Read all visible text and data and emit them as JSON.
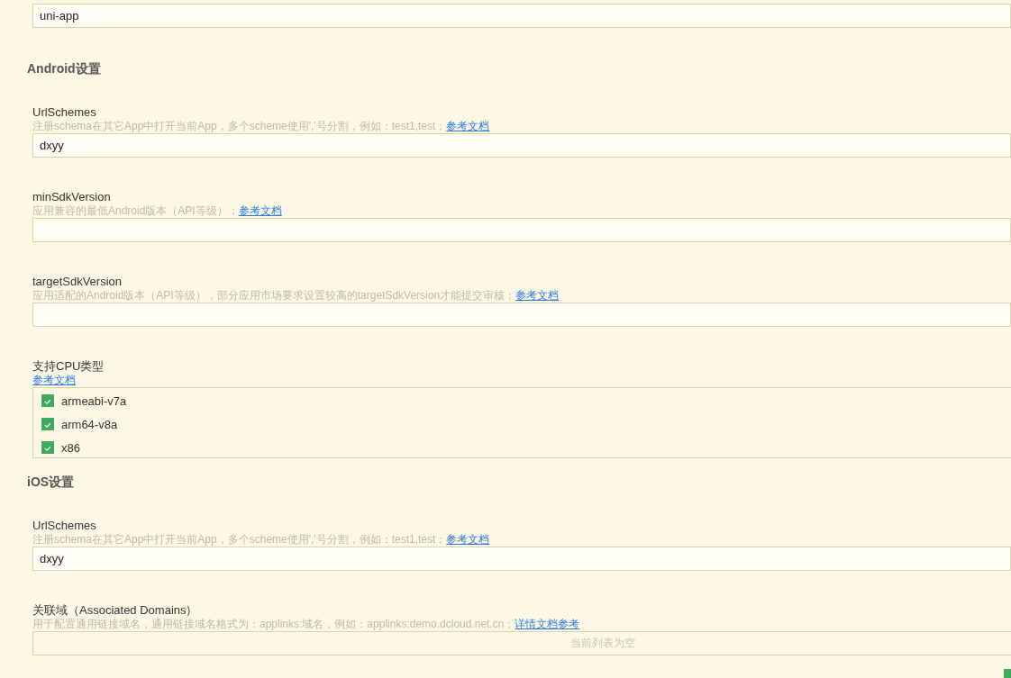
{
  "top_field": {
    "value": "uni-app"
  },
  "sections": [
    {
      "title": "Android设置",
      "settings": [
        {
          "kind": "text",
          "label": "UrlSchemes",
          "description": "注册schema在其它App中打开当前App，多个scheme使用','号分割，例如：test1,test；",
          "link": "参考文档",
          "value": "dxyy"
        },
        {
          "kind": "text",
          "label": "minSdkVersion",
          "description": "应用兼容的最低Android版本（API等级）；",
          "link": "参考文档"
        },
        {
          "kind": "text",
          "label": "targetSdkVersion",
          "description": "应用适配的Android版本（API等级），部分应用市场要求设置较高的targetSdkVersion才能提交审核；",
          "link": "参考文档"
        },
        {
          "kind": "checklist",
          "label": "支持CPU类型",
          "link": "参考文档",
          "options": [
            {
              "label": "armeabi-v7a",
              "checked": true
            },
            {
              "label": "arm64-v8a",
              "checked": true
            },
            {
              "label": "x86",
              "checked": true
            }
          ]
        }
      ]
    },
    {
      "title": "iOS设置",
      "settings": [
        {
          "kind": "text",
          "label": "UrlSchemes",
          "description": "注册schema在其它App中打开当前App，多个scheme使用','号分割，例如：test1,test；",
          "link": "参考文档",
          "value": "dxyy"
        },
        {
          "kind": "list",
          "label": "关联域（Associated Domains）",
          "description": "用于配置通用链接域名，通用链接域名格式为：applinks:域名，例如：applinks:demo.dcloud.net.cn；",
          "link": "详情文档参考",
          "empty_text": "当前列表为空"
        }
      ]
    }
  ]
}
